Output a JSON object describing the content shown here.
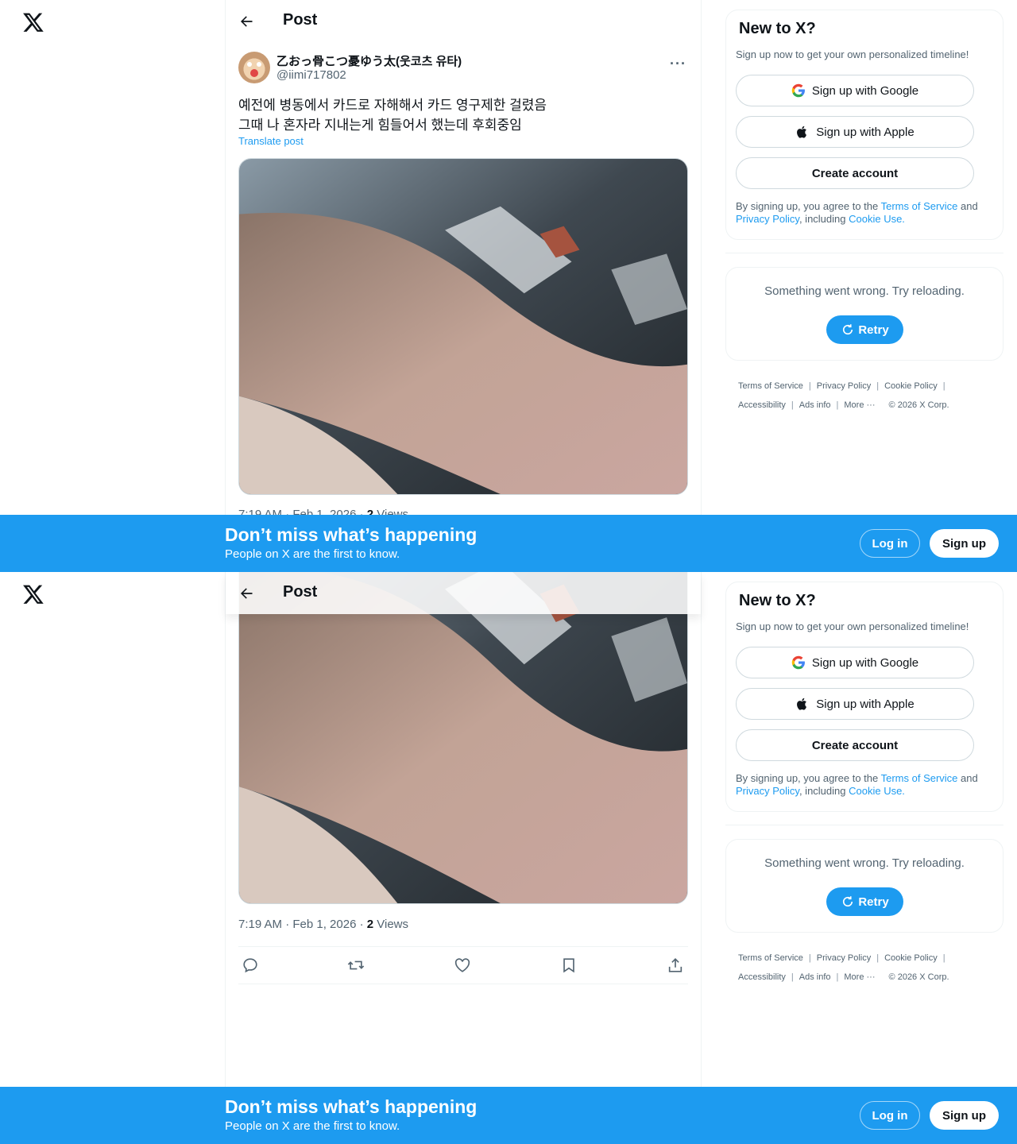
{
  "page": {
    "header_title": "Post"
  },
  "post": {
    "display_name": "乙おっ骨こつ憂ゆう太(웃코츠 유타)",
    "handle": "@iimi717802",
    "text": "예전에 병동에서 카드로 자해해서 카드 영구제한 걸렸음\n그때 나 혼자라 지내는게 힘들어서 했는데 후회중임",
    "translate_label": "Translate post",
    "time_date": "7:19 AM · Feb 1, 2026 · ",
    "views_count": "2",
    "views_label": " Views"
  },
  "icons": {
    "logo": "x-logo-icon",
    "back": "back-arrow-icon",
    "more": "more-dots-icon",
    "reply": "reply-icon",
    "repost": "repost-icon",
    "like": "heart-icon",
    "bookmark": "bookmark-icon",
    "share": "share-icon",
    "google": "google-icon",
    "apple": "apple-icon",
    "retry": "refresh-icon"
  },
  "sidebar": {
    "signup_title": "New to X?",
    "signup_sub": "Sign up now to get your own personalized timeline!",
    "google_label": "Sign up with Google",
    "apple_label": "Sign up with Apple",
    "create_label": "Create account",
    "terms_pre": "By signing up, you agree to the ",
    "terms_tos": "Terms of Service",
    "terms_and": " and ",
    "terms_privacy": "Privacy Policy",
    "terms_including": ", including ",
    "terms_cookie": "Cookie Use.",
    "error_text": "Something went wrong. Try reloading.",
    "retry_label": "Retry"
  },
  "footer": {
    "tos": "Terms of Service",
    "privacy": "Privacy Policy",
    "cookie": "Cookie Policy",
    "accessibility": "Accessibility",
    "ads": "Ads info",
    "more": "More ···",
    "copyright": "© 2026 X Corp."
  },
  "banner": {
    "title": "Don’t miss what’s happening",
    "subtitle": "People on X are the first to know.",
    "login_label": "Log in",
    "signup_label": "Sign up"
  },
  "colors": {
    "accent": "#1d9bf0",
    "text": "#0f1419",
    "secondary": "#536471",
    "border": "#eff3f4"
  }
}
